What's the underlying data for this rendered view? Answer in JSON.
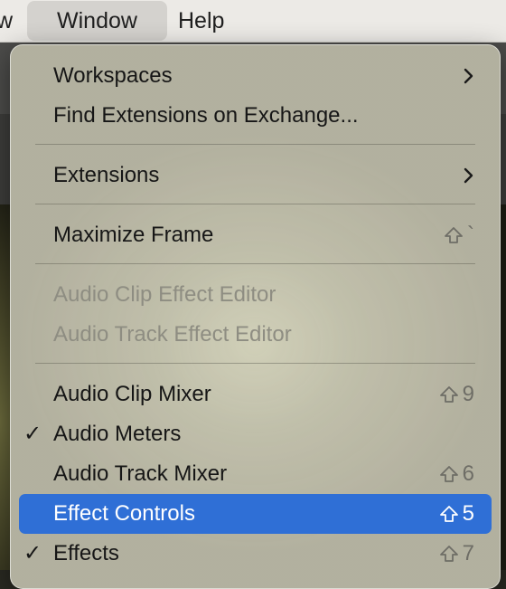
{
  "menubar": {
    "prev_fragment": "w",
    "window": "Window",
    "help": "Help"
  },
  "menu": {
    "items": [
      {
        "label": "Workspaces",
        "submenu": true
      },
      {
        "label": "Find Extensions on Exchange..."
      },
      {
        "label": "Extensions",
        "submenu": true
      },
      {
        "label": "Maximize Frame",
        "shortcut_key": "`",
        "shortcut_modifier": "shift-icon"
      },
      {
        "label": "Audio Clip Effect Editor",
        "enabled": false
      },
      {
        "label": "Audio Track Effect Editor",
        "enabled": false
      },
      {
        "label": "Audio Clip Mixer",
        "shortcut_key": "9",
        "shortcut_modifier": "shift-icon"
      },
      {
        "label": "Audio Meters",
        "checked": true
      },
      {
        "label": "Audio Track Mixer",
        "shortcut_key": "6",
        "shortcut_modifier": "shift-icon"
      },
      {
        "label": "Effect Controls",
        "shortcut_key": "5",
        "shortcut_modifier": "shift-icon",
        "highlighted": true
      },
      {
        "label": "Effects",
        "checked": true,
        "shortcut_key": "7",
        "shortcut_modifier": "shift-icon"
      }
    ],
    "check_glyph": "✓"
  },
  "colors": {
    "highlight": "#2f6fd6",
    "disabled_text": "#8e8d82",
    "shortcut_text": "#6e6d66"
  }
}
